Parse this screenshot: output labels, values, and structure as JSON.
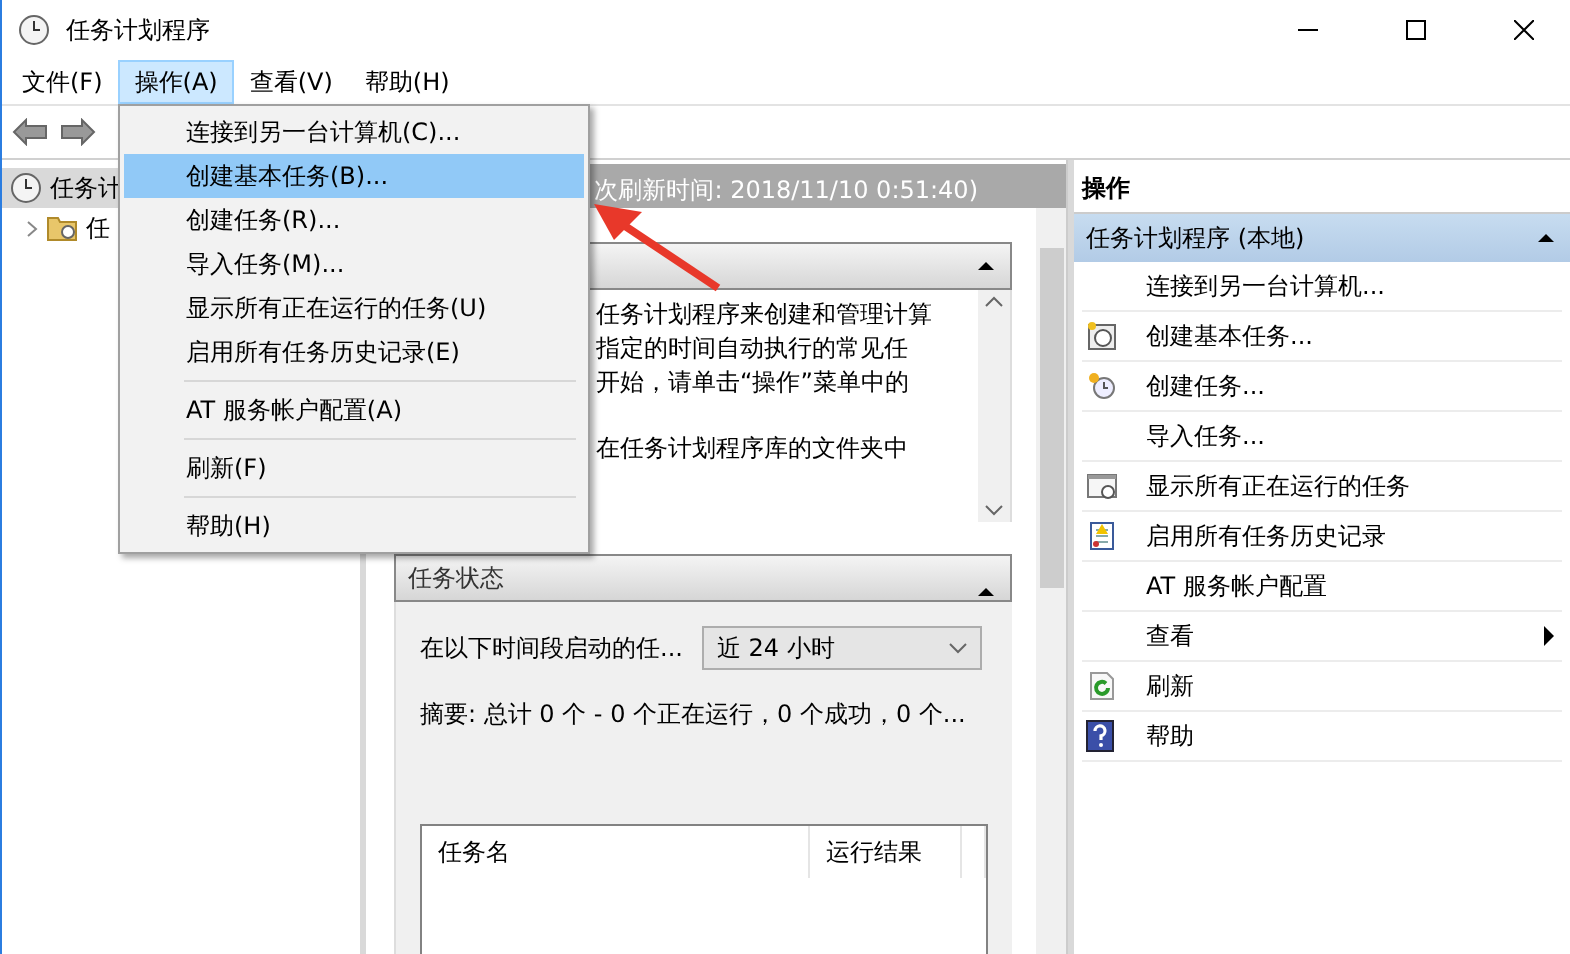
{
  "window": {
    "title": "任务计划程序"
  },
  "menu_bar": [
    {
      "label": "文件(F)",
      "selected": false
    },
    {
      "label": "操作(A)",
      "selected": true
    },
    {
      "label": "查看(V)",
      "selected": false
    },
    {
      "label": "帮助(H)",
      "selected": false
    }
  ],
  "tree": [
    {
      "label": "任务计",
      "selected": true,
      "children": [
        {
          "label": "任",
          "selected": false
        }
      ]
    }
  ],
  "open_menu": [
    {
      "kind": "item",
      "label": "连接到另一台计算机(C)...",
      "selected": false
    },
    {
      "kind": "item",
      "label": "创建基本任务(B)...",
      "selected": true
    },
    {
      "kind": "item",
      "label": "创建任务(R)...",
      "selected": false
    },
    {
      "kind": "item",
      "label": "导入任务(M)...",
      "selected": false
    },
    {
      "kind": "item",
      "label": "显示所有正在运行的任务(U)",
      "selected": false
    },
    {
      "kind": "item",
      "label": "启用所有任务历史记录(E)",
      "selected": false
    },
    {
      "kind": "separator"
    },
    {
      "kind": "item",
      "label": "AT 服务帐户配置(A)",
      "selected": false
    },
    {
      "kind": "separator"
    },
    {
      "kind": "item",
      "label": "刷新(F)",
      "selected": false
    },
    {
      "kind": "separator"
    },
    {
      "kind": "item",
      "label": "帮助(H)",
      "selected": false
    }
  ],
  "center": {
    "header": "次刷新时间: 2018/11/10 0:51:40)",
    "overview": {
      "lines": [
        "任务计划程序来创建和管理计算",
        "指定的时间自动执行的常见任",
        "开始，请单击“操作”菜单中的"
      ],
      "lines_after_gap": [
        "在任务计划程序库的文件夹中"
      ]
    },
    "status": {
      "title": "任务状态",
      "range_label": "在以下时间段启动的任...",
      "range_value": "近 24 小时",
      "summary": "摘要: 总计 0 个 - 0 个正在运行，0 个成功，0 个...",
      "columns": [
        "任务名",
        "运行结果"
      ]
    }
  },
  "actions": {
    "title": "操作",
    "group": "任务计划程序 (本地)",
    "items": [
      {
        "kind": "plain",
        "label": "连接到另一台计算机..."
      },
      {
        "kind": "create-basic",
        "label": "创建基本任务..."
      },
      {
        "kind": "create",
        "label": "创建任务..."
      },
      {
        "kind": "plain",
        "label": "导入任务..."
      },
      {
        "kind": "running",
        "label": "显示所有正在运行的任务"
      },
      {
        "kind": "history",
        "label": "启用所有任务历史记录"
      },
      {
        "kind": "plain",
        "label": "AT 服务帐户配置"
      },
      {
        "kind": "submenu",
        "label": "查看"
      },
      {
        "kind": "refresh",
        "label": "刷新"
      },
      {
        "kind": "help",
        "label": "帮助"
      }
    ]
  }
}
